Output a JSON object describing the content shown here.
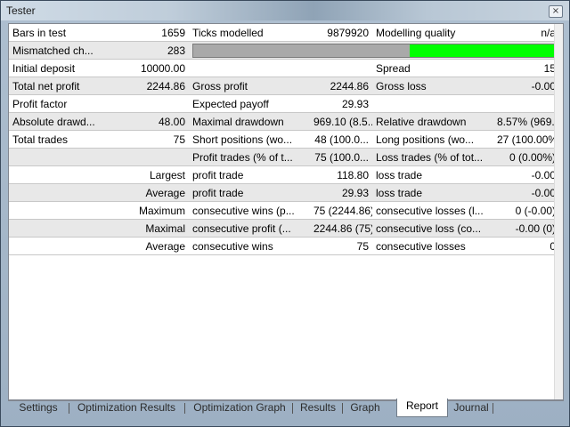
{
  "window": {
    "title": "Tester",
    "close_glyph": "×"
  },
  "quality_bar": {
    "gray_fraction": 0.6,
    "fill_color": "#00ff00"
  },
  "rows": [
    [
      "Bars in test",
      "1659",
      "Ticks modelled",
      "9879920",
      "Modelling quality",
      "n/a"
    ],
    [
      "Mismatched ch...",
      "283",
      "",
      "",
      "",
      ""
    ],
    [
      "Initial deposit",
      "10000.00",
      "",
      "",
      "Spread",
      "15"
    ],
    [
      "Total net profit",
      "2244.86",
      "Gross profit",
      "2244.86",
      "Gross loss",
      "-0.00"
    ],
    [
      "Profit factor",
      "",
      "Expected payoff",
      "29.93",
      "",
      ""
    ],
    [
      "Absolute drawd...",
      "48.00",
      "Maximal drawdown",
      "969.10 (8.5...",
      "Relative drawdown",
      "8.57% (969...."
    ],
    [
      "Total trades",
      "75",
      "Short positions (wo...",
      "48 (100.0...",
      "Long positions (wo...",
      "27 (100.00%)"
    ],
    [
      "",
      "",
      "Profit trades (% of t...",
      "75 (100.0...",
      "Loss trades (% of tot...",
      "0 (0.00%)"
    ],
    [
      "",
      "Largest",
      "profit trade",
      "118.80",
      "loss trade",
      "-0.00"
    ],
    [
      "",
      "Average",
      "profit trade",
      "29.93",
      "loss trade",
      "-0.00"
    ],
    [
      "",
      "Maximum",
      "consecutive wins (p...",
      "75 (2244.86)",
      "consecutive losses (l...",
      "0 (-0.00)"
    ],
    [
      "",
      "Maximal",
      "consecutive profit (...",
      "2244.86 (75)",
      "consecutive loss (co...",
      "-0.00 (0)"
    ],
    [
      "",
      "Average",
      "consecutive wins",
      "75",
      "consecutive losses",
      "0"
    ]
  ],
  "tabs": [
    {
      "label": "Settings",
      "active": false
    },
    {
      "label": "Optimization Results",
      "active": false
    },
    {
      "label": "Optimization Graph",
      "active": false
    },
    {
      "label": "Results",
      "active": false
    },
    {
      "label": "Graph",
      "active": false
    },
    {
      "label": "Report",
      "active": true
    },
    {
      "label": "Journal",
      "active": false
    }
  ]
}
